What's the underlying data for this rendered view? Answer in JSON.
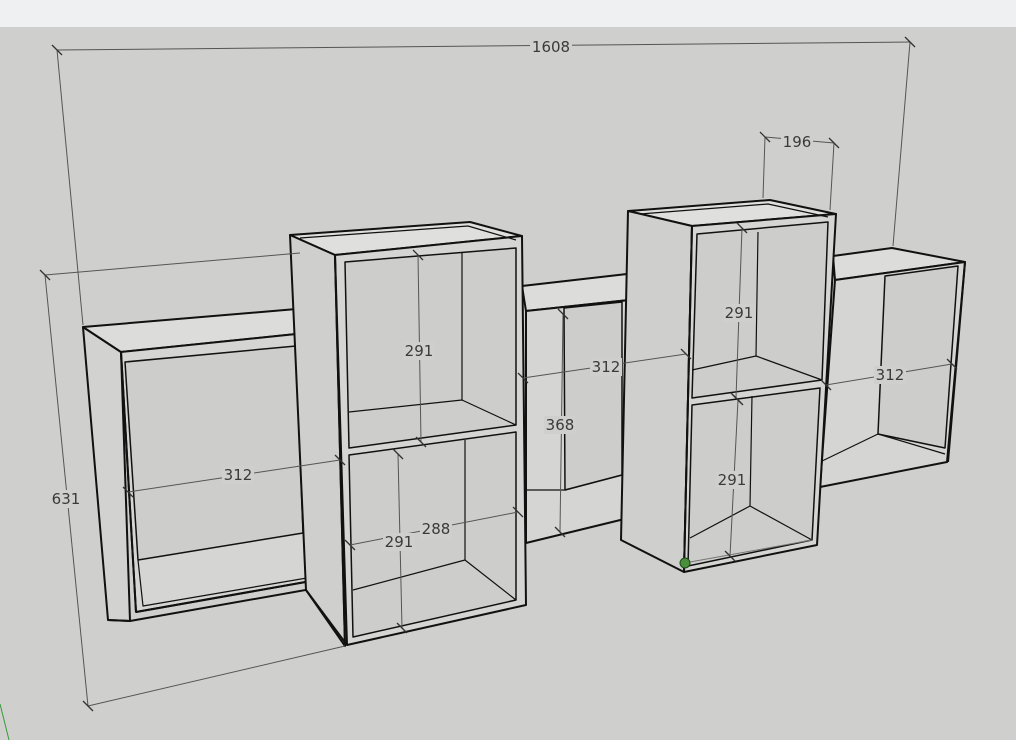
{
  "dimensions": {
    "overall_width": "1608",
    "overall_height": "631",
    "depth": "196",
    "left_cell_width": "312",
    "center_cell_width": "312",
    "right_cell_width": "312",
    "tower1_top_height": "291",
    "tower1_bottom_height": "291",
    "tower1_width": "288",
    "center_height": "368",
    "tower2_top_height": "291",
    "tower2_bottom_height": "291"
  },
  "colors": {
    "background": "#cfcfcd",
    "panel_face": "#d9d9d7",
    "edge": "#111111",
    "dimension_line": "#555555",
    "selection_point": "#4a8f3c"
  }
}
